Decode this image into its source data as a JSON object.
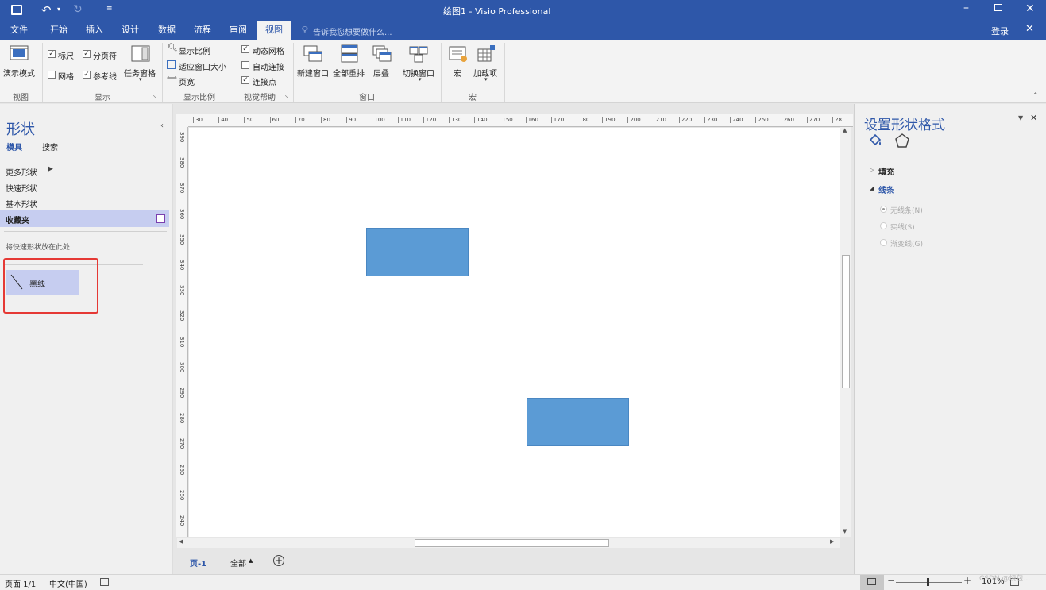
{
  "window": {
    "title": "绘图1 - Visio Professional"
  },
  "tabs": [
    "文件",
    "开始",
    "插入",
    "设计",
    "数据",
    "流程",
    "审阅",
    "视图"
  ],
  "active_tab": "视图",
  "tell_me": "告诉我您想要做什么...",
  "login": "登录",
  "ribbon": {
    "presentation_mode": "演示模式",
    "ruler": "标尺",
    "page_breaks": "分页符",
    "grid": "网格",
    "guides": "参考线",
    "task_panes": "任务窗格",
    "zoom": "显示比例",
    "fit_to_window": "适应窗口大小",
    "page_width": "页宽",
    "dynamic_grid": "动态网格",
    "auto_connect": "自动连接",
    "connection_points": "连接点",
    "new_window": "新建窗口",
    "arrange_all": "全部重排",
    "cascade": "层叠",
    "switch_windows": "切换窗口",
    "macros": "宏",
    "addons": "加载项",
    "groups": {
      "view": "视图",
      "show": "显示",
      "zoom": "显示比例",
      "visual_aids": "视觉帮助",
      "window": "窗口",
      "macros": "宏"
    }
  },
  "shapes_pane": {
    "title": "形状",
    "tabs": [
      "模具",
      "搜索"
    ],
    "items": [
      "更多形状",
      "快速形状",
      "基本形状",
      "收藏夹"
    ],
    "drop_hint": "将快速形状放在此处",
    "stencil_item": "黑线"
  },
  "format_pane": {
    "title": "设置形状格式",
    "sections": [
      "填充",
      "线条"
    ],
    "line_options": [
      "无线条(N)",
      "实线(S)",
      "渐变线(G)"
    ]
  },
  "ruler": {
    "h_ticks": [
      "30",
      "40",
      "50",
      "60",
      "70",
      "80",
      "90",
      "100",
      "110",
      "120",
      "130",
      "140",
      "150",
      "160",
      "170",
      "180",
      "190",
      "200",
      "210",
      "220",
      "230",
      "240",
      "250",
      "260",
      "270",
      "28"
    ],
    "v_ticks": [
      "390",
      "380",
      "370",
      "360",
      "350",
      "340",
      "330",
      "320",
      "310",
      "300",
      "290",
      "280",
      "270",
      "260",
      "250",
      "240"
    ]
  },
  "page_tabs": {
    "current": "页-1",
    "all": "全部"
  },
  "status": {
    "page": "页面 1/1",
    "language": "中文(中国)",
    "zoom": "101%",
    "watermark": "CSDN @烧包..."
  },
  "colors": {
    "brand": "#2e57a9",
    "shape_fill": "#5b9bd5",
    "highlight": "#c6cdf0",
    "annotation": "#e53935"
  }
}
